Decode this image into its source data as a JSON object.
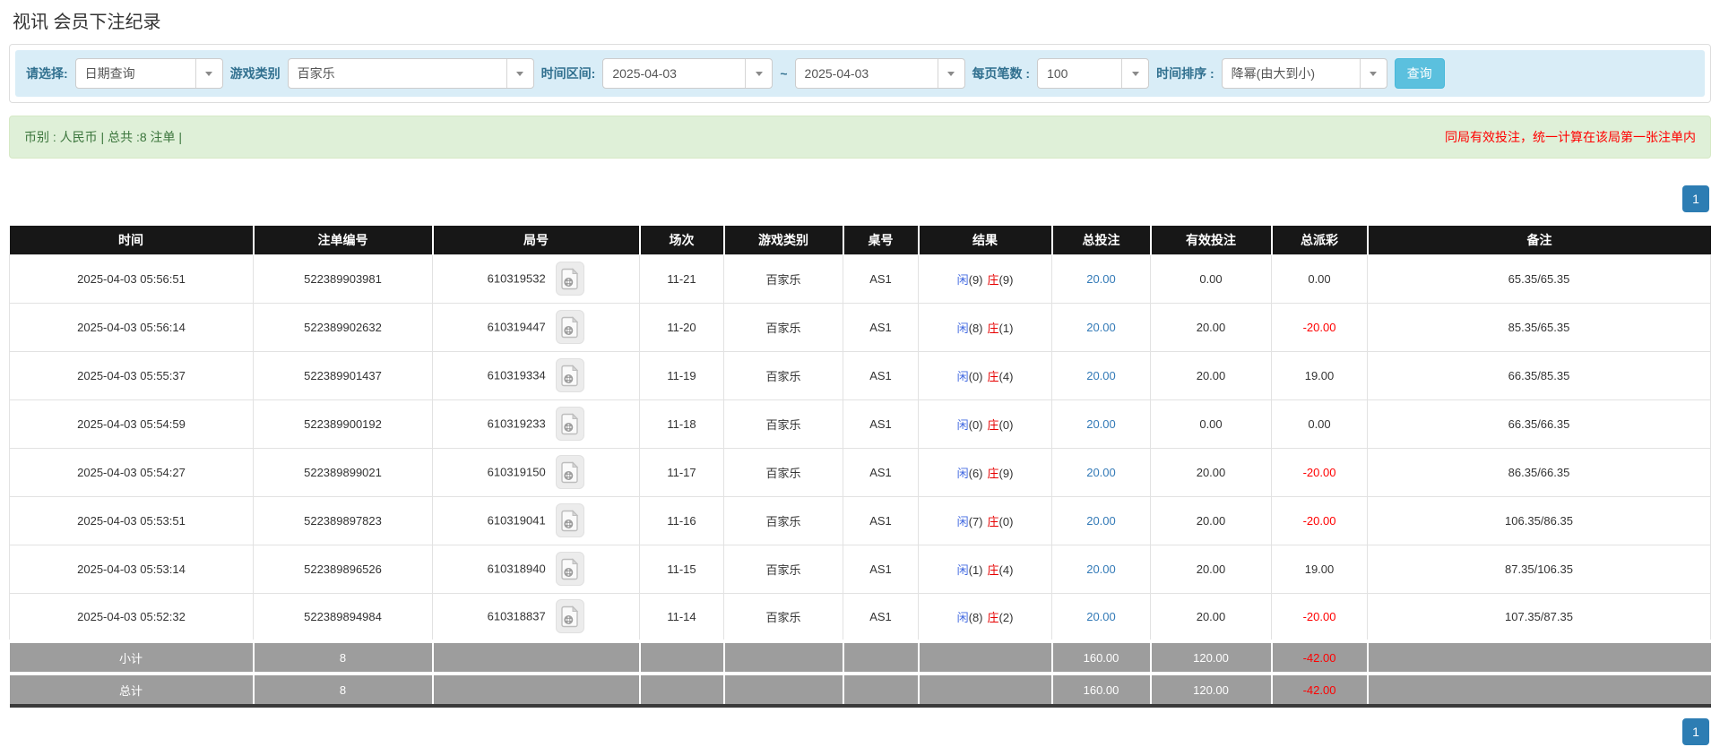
{
  "page": {
    "title": "视讯 会员下注纪录"
  },
  "filters": {
    "select_label": "请选择:",
    "select_value": "日期查询",
    "game_type_label": "游戏类别",
    "game_type_value": "百家乐",
    "time_range_label": "时间区间:",
    "date_from": "2025-04-03",
    "date_separator": "~",
    "date_to": "2025-04-03",
    "page_size_label": "每页笔数 :",
    "page_size_value": "100",
    "sort_label": "时间排序 :",
    "sort_value": "降幂(由大到小)",
    "search_button": "查询"
  },
  "summary": {
    "info": "币别 : 人民币 | 总共 :8 注单 |",
    "notice": "同局有效投注，统一计算在该局第一张注单内"
  },
  "pagination": {
    "page": "1"
  },
  "table": {
    "headers": [
      "时间",
      "注单编号",
      "局号",
      "场次",
      "游戏类别",
      "桌号",
      "结果",
      "总投注",
      "有效投注",
      "总派彩",
      "备注"
    ],
    "rows": [
      {
        "time": "2025-04-03 05:56:51",
        "bet_id": "522389903981",
        "round_id": "610319532",
        "session": "11-21",
        "game": "百家乐",
        "table_no": "AS1",
        "result": {
          "player": "闲",
          "player_pts": "(9)",
          "banker": "庄",
          "banker_pts": "(9)"
        },
        "total_bet": "20.00",
        "valid_bet": "0.00",
        "payout": "0.00",
        "remark": "65.35/65.35"
      },
      {
        "time": "2025-04-03 05:56:14",
        "bet_id": "522389902632",
        "round_id": "610319447",
        "session": "11-20",
        "game": "百家乐",
        "table_no": "AS1",
        "result": {
          "player": "闲",
          "player_pts": "(8)",
          "banker": "庄",
          "banker_pts": "(1)"
        },
        "total_bet": "20.00",
        "valid_bet": "20.00",
        "payout": "-20.00",
        "remark": "85.35/65.35"
      },
      {
        "time": "2025-04-03 05:55:37",
        "bet_id": "522389901437",
        "round_id": "610319334",
        "session": "11-19",
        "game": "百家乐",
        "table_no": "AS1",
        "result": {
          "player": "闲",
          "player_pts": "(0)",
          "banker": "庄",
          "banker_pts": "(4)"
        },
        "total_bet": "20.00",
        "valid_bet": "20.00",
        "payout": "19.00",
        "remark": "66.35/85.35"
      },
      {
        "time": "2025-04-03 05:54:59",
        "bet_id": "522389900192",
        "round_id": "610319233",
        "session": "11-18",
        "game": "百家乐",
        "table_no": "AS1",
        "result": {
          "player": "闲",
          "player_pts": "(0)",
          "banker": "庄",
          "banker_pts": "(0)"
        },
        "total_bet": "20.00",
        "valid_bet": "0.00",
        "payout": "0.00",
        "remark": "66.35/66.35"
      },
      {
        "time": "2025-04-03 05:54:27",
        "bet_id": "522389899021",
        "round_id": "610319150",
        "session": "11-17",
        "game": "百家乐",
        "table_no": "AS1",
        "result": {
          "player": "闲",
          "player_pts": "(6)",
          "banker": "庄",
          "banker_pts": "(9)"
        },
        "total_bet": "20.00",
        "valid_bet": "20.00",
        "payout": "-20.00",
        "remark": "86.35/66.35"
      },
      {
        "time": "2025-04-03 05:53:51",
        "bet_id": "522389897823",
        "round_id": "610319041",
        "session": "11-16",
        "game": "百家乐",
        "table_no": "AS1",
        "result": {
          "player": "闲",
          "player_pts": "(7)",
          "banker": "庄",
          "banker_pts": "(0)"
        },
        "total_bet": "20.00",
        "valid_bet": "20.00",
        "payout": "-20.00",
        "remark": "106.35/86.35"
      },
      {
        "time": "2025-04-03 05:53:14",
        "bet_id": "522389896526",
        "round_id": "610318940",
        "session": "11-15",
        "game": "百家乐",
        "table_no": "AS1",
        "result": {
          "player": "闲",
          "player_pts": "(1)",
          "banker": "庄",
          "banker_pts": "(4)"
        },
        "total_bet": "20.00",
        "valid_bet": "20.00",
        "payout": "19.00",
        "remark": "87.35/106.35"
      },
      {
        "time": "2025-04-03 05:52:32",
        "bet_id": "522389894984",
        "round_id": "610318837",
        "session": "11-14",
        "game": "百家乐",
        "table_no": "AS1",
        "result": {
          "player": "闲",
          "player_pts": "(8)",
          "banker": "庄",
          "banker_pts": "(2)"
        },
        "total_bet": "20.00",
        "valid_bet": "20.00",
        "payout": "-20.00",
        "remark": "107.35/87.35"
      }
    ],
    "footer": [
      {
        "label": "小计",
        "count": "8",
        "total_bet": "160.00",
        "valid_bet": "120.00",
        "payout": "-42.00"
      },
      {
        "label": "总计",
        "count": "8",
        "total_bet": "160.00",
        "valid_bet": "120.00",
        "payout": "-42.00"
      }
    ]
  },
  "colors": {
    "filter_bar_bg": "#d9edf7",
    "filter_label": "#31708f",
    "search_button_bg": "#5bc0de",
    "info_bar_bg": "#dff0d8",
    "info_text": "#3c763d",
    "notice_red": "#ff0000",
    "pagination_blue": "#2d7db3",
    "header_black": "#171717",
    "footer_gray": "#9d9d9d",
    "bet_link_blue": "#337ab7",
    "player_blue": "#4169e1",
    "banker_red": "#e60000",
    "negative_red": "#ff0000"
  }
}
